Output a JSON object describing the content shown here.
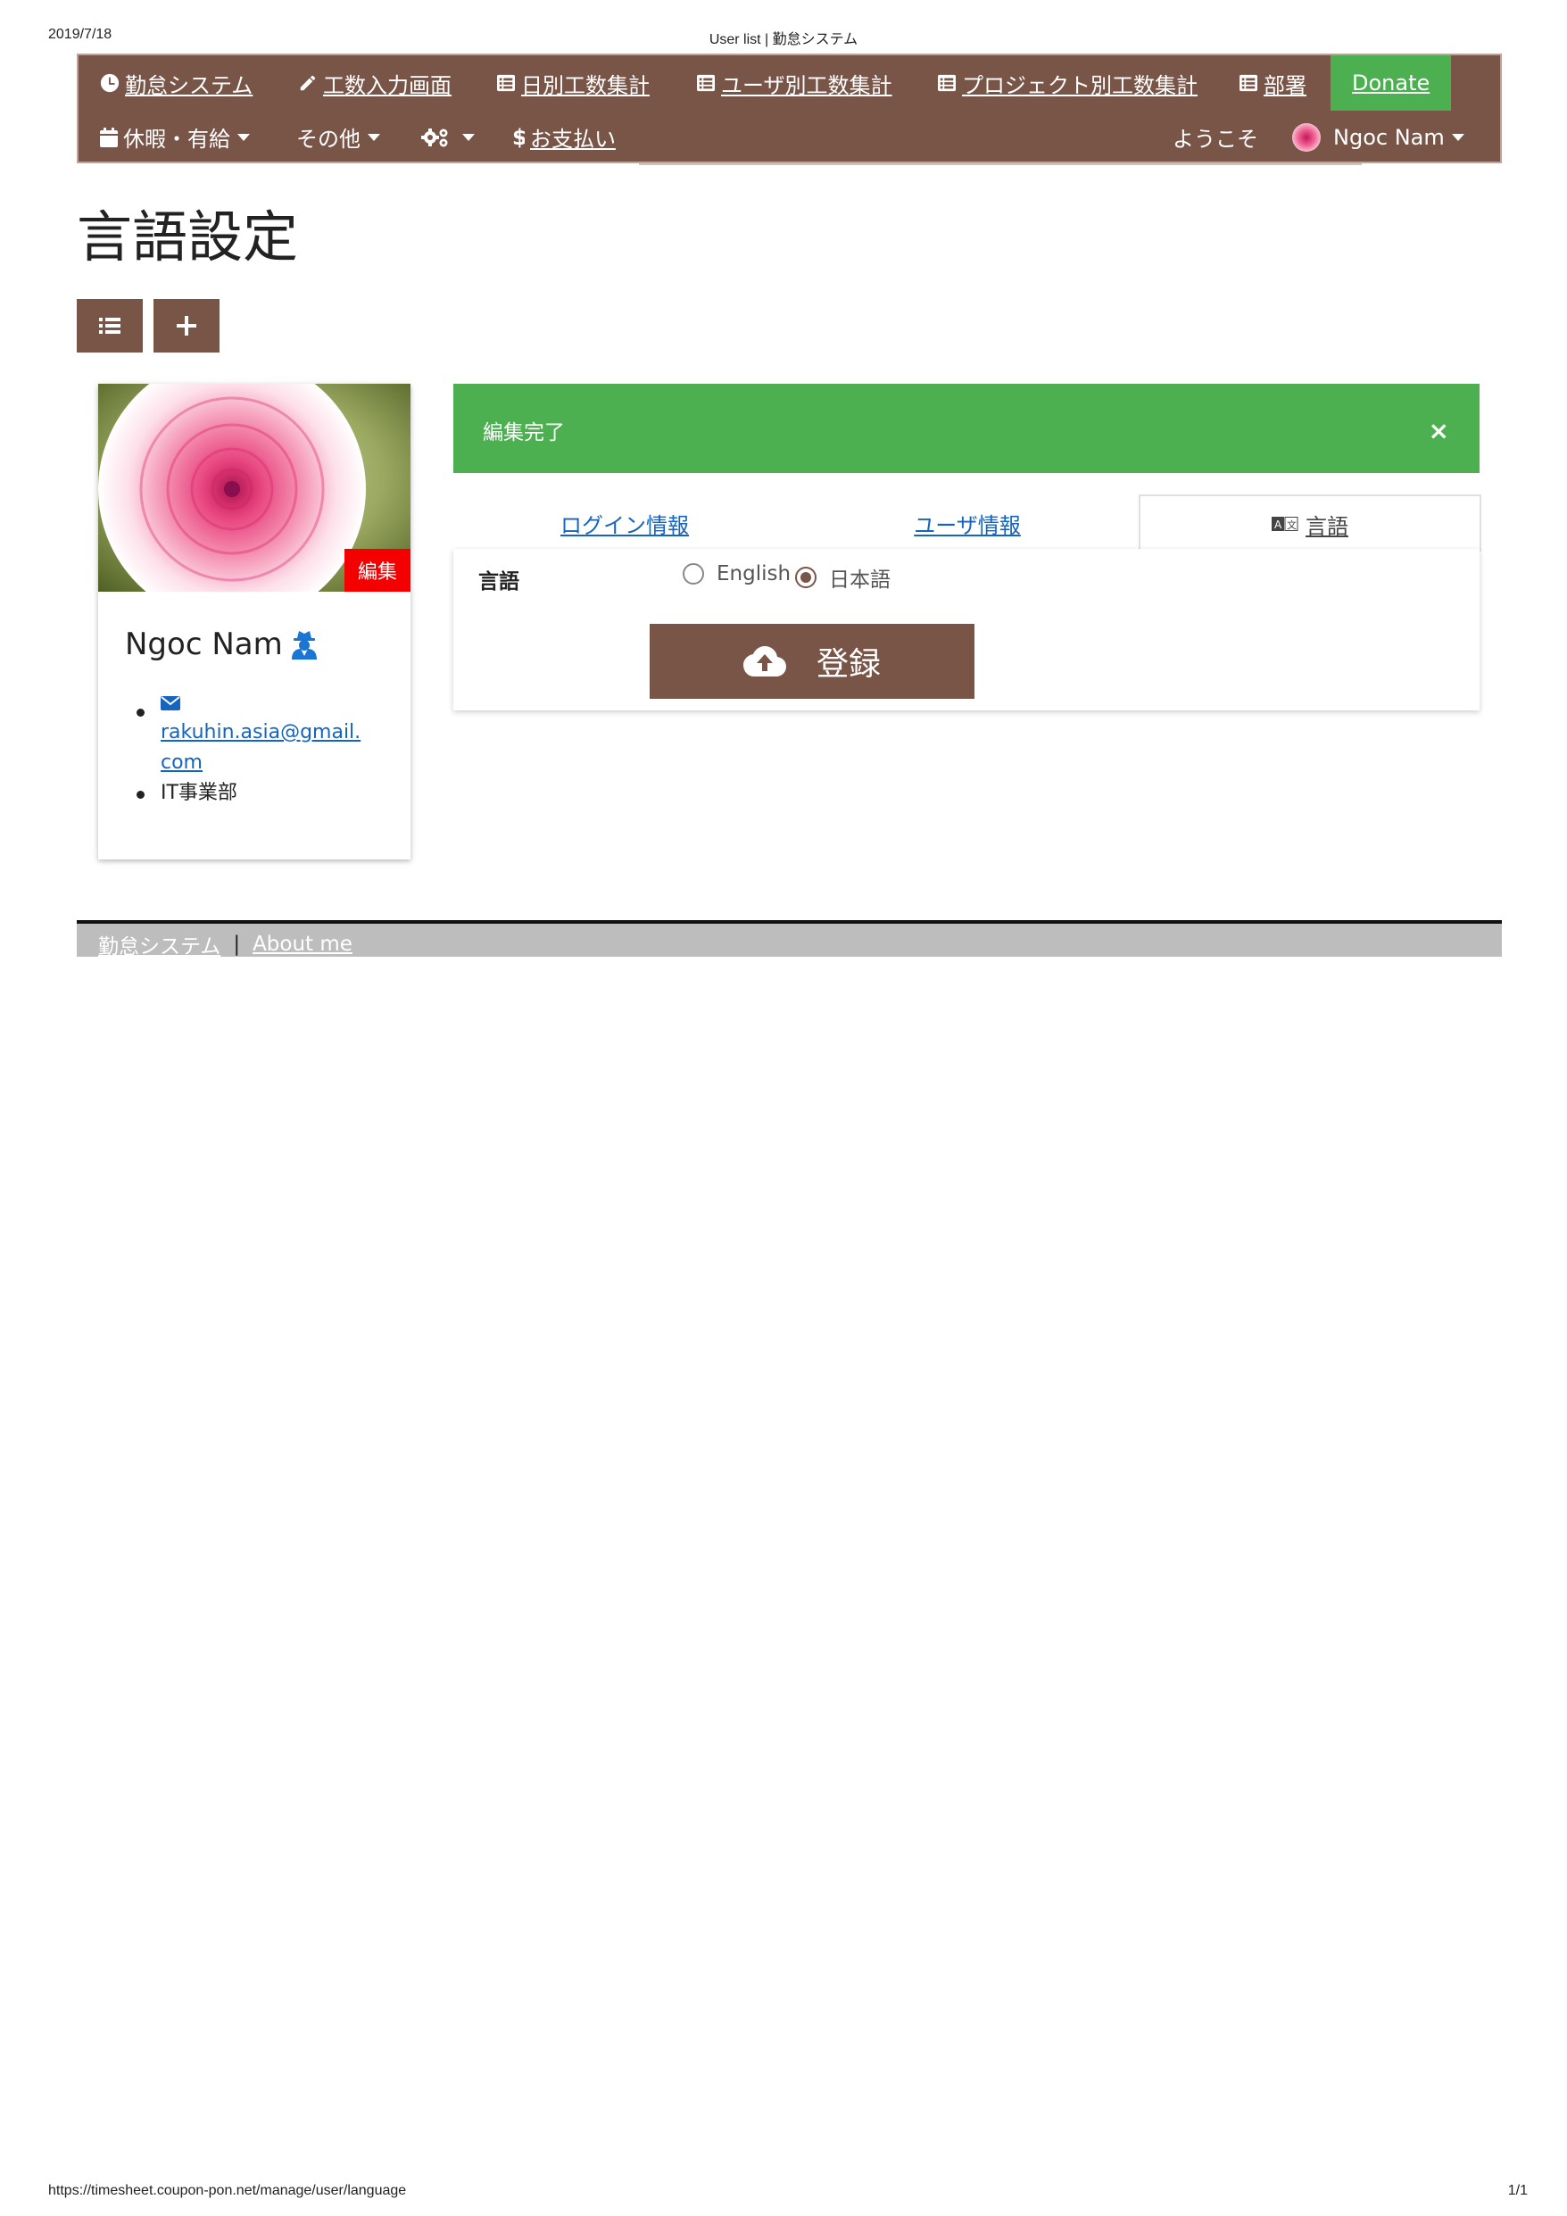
{
  "print": {
    "date": "2019/7/18",
    "title": "User list | 勤怠システム",
    "url": "https://timesheet.coupon-pon.net/manage/user/language",
    "page": "1/1"
  },
  "navbar": {
    "row1": [
      {
        "label": "勤怠システム",
        "icon": "clock-icon"
      },
      {
        "label": "工数入力画面",
        "icon": "pencil-icon"
      },
      {
        "label": "日別工数集計",
        "icon": "list-icon"
      },
      {
        "label": "ユーザ別工数集計",
        "icon": "list-icon"
      },
      {
        "label": "プロジェクト別工数集計",
        "icon": "list-icon"
      },
      {
        "label": "部署",
        "icon": "list-icon"
      },
      {
        "label": "Donate",
        "icon": ""
      }
    ],
    "row2": {
      "holiday": "休暇・有給",
      "other": "その他",
      "payment": "お支払い",
      "welcome": "ようこそ",
      "user": "Ngoc Nam"
    },
    "colors": {
      "bar": "#795548",
      "donate": "#4caf50"
    }
  },
  "page_title": "言語設定",
  "profile": {
    "edit_label": "編集",
    "name": "Ngoc Nam",
    "email": "rakuhin.asia@gmail.com",
    "department": "IT事業部"
  },
  "alert": {
    "message": "編集完了",
    "close": "×",
    "color": "#4caf50"
  },
  "tabs": [
    {
      "label": "ログイン情報",
      "active": false
    },
    {
      "label": "ユーザ情報",
      "active": false
    },
    {
      "label": "言語",
      "active": true
    }
  ],
  "form": {
    "field_label": "言語",
    "options": [
      {
        "label": "English",
        "checked": false
      },
      {
        "label": "日本語",
        "checked": true
      }
    ],
    "submit_label": "登録"
  },
  "footer": {
    "link1": "勤怠システム",
    "separator": "|",
    "link2": "About me"
  }
}
